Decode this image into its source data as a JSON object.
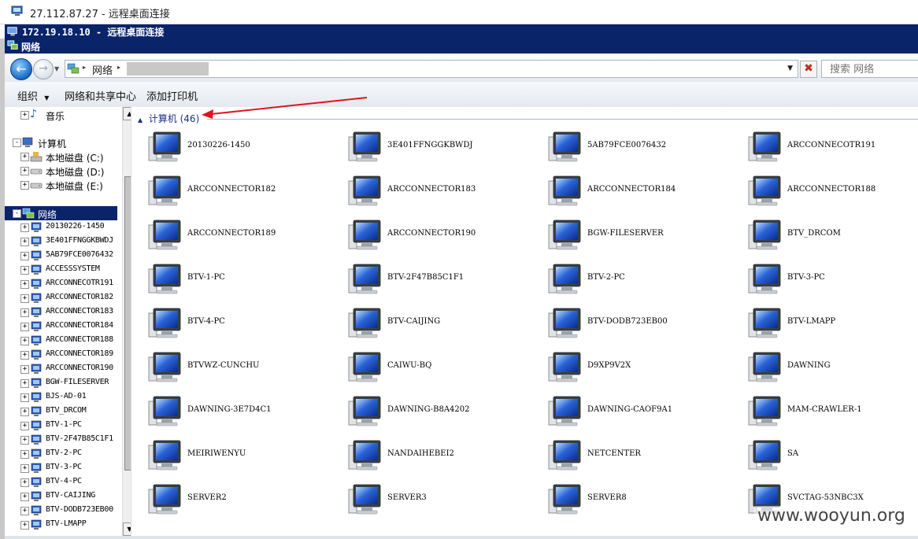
{
  "outer_window": {
    "title": "27.112.87.27 - 远程桌面连接"
  },
  "inner_window": {
    "title": "172.19.18.10 - 远程桌面连接"
  },
  "explorer": {
    "title": "网络",
    "address": {
      "crumb": "网络"
    },
    "search": {
      "placeholder": "搜索 网络"
    },
    "commands": {
      "organize": "组织",
      "network_center": "网络和共享中心",
      "add_printer": "添加打印机"
    }
  },
  "nav_tree": {
    "music": "音乐",
    "computer": "计算机",
    "disk_c": "本地磁盘 (C:)",
    "disk_d": "本地磁盘 (D:)",
    "disk_e": "本地磁盘 (E:)",
    "network": "网络",
    "hosts": [
      "20130226-1450",
      "3E401FFNGGKBWDJ",
      "5AB79FCE0076432",
      "ACCESSSYSTEM",
      "ARCCONNECOTR191",
      "ARCCONNECTOR182",
      "ARCCONNECTOR183",
      "ARCCONNECTOR184",
      "ARCCONNECTOR188",
      "ARCCONNECTOR189",
      "ARCCONNECTOR190",
      "BGW-FILESERVER",
      "BJS-AD-01",
      "BTV_DRCOM",
      "BTV-1-PC",
      "BTV-2F47B85C1F1",
      "BTV-2-PC",
      "BTV-3-PC",
      "BTV-4-PC",
      "BTV-CAIJING",
      "BTV-DODB723EB00",
      "BTV-LMAPP"
    ]
  },
  "content": {
    "group_label": "计算机 (46)",
    "computers": [
      "20130226-1450",
      "3E401FFNGGKBWDJ",
      "5AB79FCE0076432",
      "ARCCONNECOTR191",
      "ARCCONNECTOR182",
      "ARCCONNECTOR183",
      "ARCCONNECTOR184",
      "ARCCONNECTOR188",
      "ARCCONNECTOR189",
      "ARCCONNECTOR190",
      "BGW-FILESERVER",
      "BTV_DRCOM",
      "BTV-1-PC",
      "BTV-2F47B85C1F1",
      "BTV-2-PC",
      "BTV-3-PC",
      "BTV-4-PC",
      "BTV-CAIJING",
      "BTV-DODB723EB00",
      "BTV-LMAPP",
      "BTVWZ-CUNCHU",
      "CAIWU-BQ",
      "D9XP9V2X",
      "DAWNING",
      "DAWNING-3E7D4C1",
      "DAWNING-B8A4202",
      "DAWNING-CAOF9A1",
      "MAM-CRAWLER-1",
      "MEIRIWENYU",
      "NANDAIHEBEI2",
      "NETCENTER",
      "SA",
      "SERVER2",
      "SERVER3",
      "SERVER8",
      "SVCTAG-53NBC3X"
    ]
  },
  "watermark": "www.wooyun.org",
  "colors": {
    "titlebar": "#0a246a",
    "annotation_arrow": "#e0141e"
  }
}
